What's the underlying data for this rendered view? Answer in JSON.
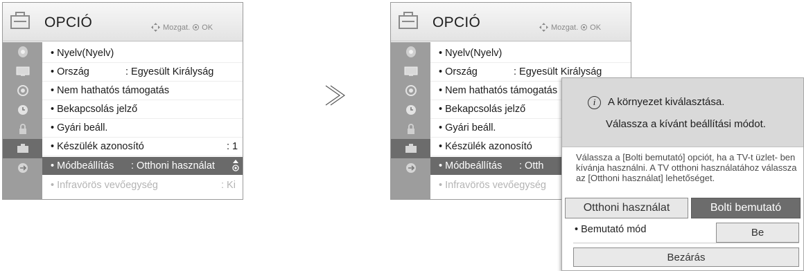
{
  "separator_arrow": "≫",
  "panels": [
    {
      "title": "OPCIÓ",
      "hint_move": "Mozgat.",
      "hint_ok": "OK",
      "menu": [
        {
          "label": "Nyelv(Nyelv)",
          "value": ""
        },
        {
          "label": "Ország",
          "value": ": Egyesült Királyság"
        },
        {
          "label": "Nem hathatós támogatás",
          "value": ""
        },
        {
          "label": "Bekapcsolás jelző",
          "value": ""
        },
        {
          "label": "Gyári beáll.",
          "value": ""
        },
        {
          "label": "Készülék azonosító",
          "value": ": 1"
        },
        {
          "label": "Módbeállítás",
          "value": ": Otthoni használat"
        },
        {
          "label": "Infravörös vevőegység",
          "value": ": Ki"
        }
      ]
    },
    {
      "title": "OPCIÓ",
      "hint_move": "Mozgat.",
      "hint_ok": "OK",
      "menu": [
        {
          "label": "Nyelv(Nyelv)",
          "value": ""
        },
        {
          "label": "Ország",
          "value": ": Egyesült Királyság"
        },
        {
          "label": "Nem hathatós támogatás",
          "value": ""
        },
        {
          "label": "Bekapcsolás jelző",
          "value": ""
        },
        {
          "label": "Gyári beáll.",
          "value": ""
        },
        {
          "label": "Készülék azonosító",
          "value": ""
        },
        {
          "label": "Módbeállítás",
          "value": ": Otth"
        },
        {
          "label": "Infravörös vevőegység",
          "value": ""
        }
      ]
    }
  ],
  "popup": {
    "info_glyph": "i",
    "heading_line1": "A környezet kiválasztása.",
    "heading_line2": "Válassza a kívánt beállítási módot.",
    "description": "Válassza a [Bolti bemutató] opciót, ha a TV-t üzlet- ben kívánja használni. A TV otthoni használatához válassza az [Otthoni használat] lehetőséget.",
    "option_home": "Otthoni használat",
    "option_shop": "Bolti bemutató",
    "demo_mode_label": "• Bemutató mód",
    "demo_mode_value": "Be",
    "close_label": "Bezárás"
  },
  "colors": {
    "selected_row": "#6a6a6a",
    "sidebar": "#9d9d9d",
    "popup_header": "#d9d9d9"
  }
}
